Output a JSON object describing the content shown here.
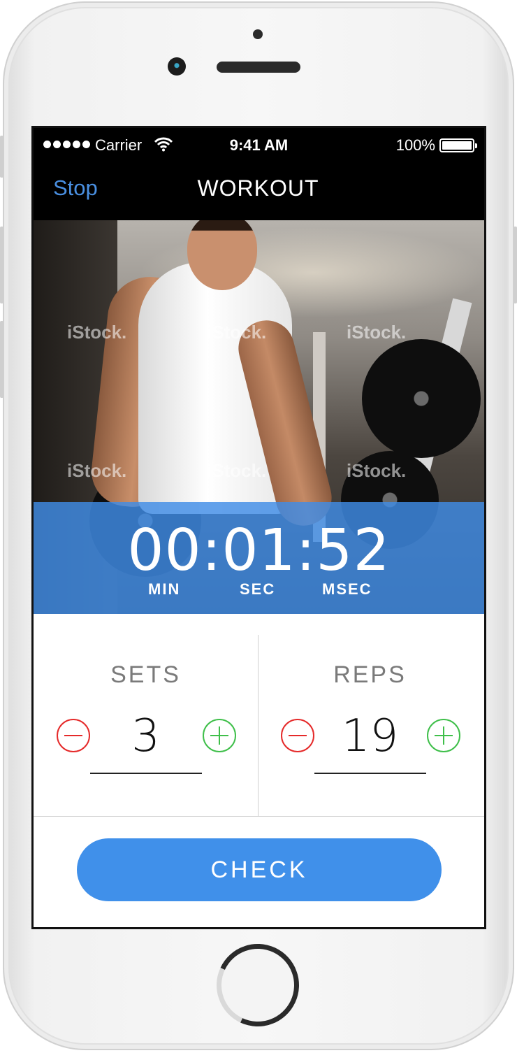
{
  "status_bar": {
    "carrier": "Carrier",
    "time": "9:41 AM",
    "battery_percent": "100%",
    "icons": [
      "signal-dots-icon",
      "wifi-icon",
      "battery-icon"
    ]
  },
  "nav": {
    "left_button": "Stop",
    "title": "WORKOUT"
  },
  "hero": {
    "watermarks": [
      "iStock.",
      "iStock.",
      "iStock.",
      "iStock.",
      "iStock.",
      "iStock."
    ]
  },
  "timer": {
    "value": "00:01:52",
    "labels": {
      "min": "MIN",
      "sec": "SEC",
      "msec": "MSEC"
    }
  },
  "counters": {
    "sets": {
      "title": "SETS",
      "value": "3"
    },
    "reps": {
      "title": "REPS",
      "value": "19"
    }
  },
  "actions": {
    "check": "CHECK"
  },
  "colors": {
    "accent_blue": "#4090ea",
    "minus_red": "#e52a2a",
    "plus_green": "#3fbf4a"
  }
}
